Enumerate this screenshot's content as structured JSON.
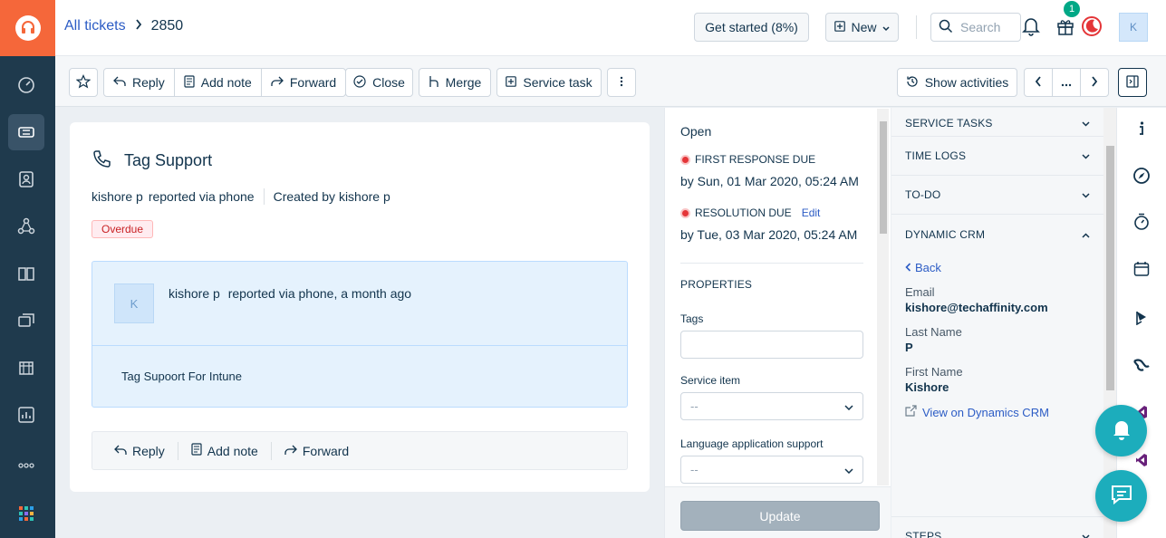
{
  "topbar": {
    "breadcrumb_root": "All tickets",
    "ticket_id": "2850",
    "get_started": "Get started (8%)",
    "new_label": "New",
    "search_placeholder": "Search",
    "gift_badge": "1",
    "avatar_initial": "K"
  },
  "toolbar": {
    "reply": "Reply",
    "add_note": "Add note",
    "forward": "Forward",
    "close": "Close",
    "merge": "Merge",
    "service_task": "Service task",
    "show_activities": "Show activities"
  },
  "ticket": {
    "subject": "Tag Support",
    "reporter": "kishore p",
    "reported_via": "reported via phone",
    "created_by": "Created by kishore p",
    "overdue_badge": "Overdue",
    "conversation": {
      "avatar_initial": "K",
      "author": "kishore p",
      "header_rest": "reported via phone, a month ago",
      "body": "Tag Supoort For Intune"
    },
    "reply_bar": {
      "reply": "Reply",
      "add_note": "Add note",
      "forward": "Forward"
    }
  },
  "properties": {
    "status": "Open",
    "first_response_label": "FIRST RESPONSE DUE",
    "first_response_value": "by Sun, 01 Mar 2020, 05:24 AM",
    "resolution_label": "RESOLUTION DUE",
    "resolution_edit": "Edit",
    "resolution_value": "by Tue, 03 Mar 2020, 05:24 AM",
    "section_title": "PROPERTIES",
    "tags_label": "Tags",
    "tags_value": "",
    "service_item_label": "Service item",
    "service_item_value": "--",
    "language_label": "Language application support",
    "language_value": "--",
    "update_button": "Update"
  },
  "apps": {
    "service_tasks": "SERVICE TASKS",
    "time_logs": "TIME LOGS",
    "todo": "TO-DO",
    "dynamic_crm": "DYNAMIC CRM",
    "back": "Back",
    "email_label": "Email",
    "email_value": "kishore@techaffinity.com",
    "last_name_label": "Last Name",
    "last_name_value": "P",
    "first_name_label": "First Name",
    "first_name_value": "Kishore",
    "view_link": "View on Dynamics CRM",
    "steps": "STEPS"
  },
  "colors": {
    "brand_orange": "#f5673a",
    "sidebar": "#1f3a4d",
    "link_blue": "#2c5cc5",
    "fab_teal": "#1cadbc",
    "overdue_red": "#c82124"
  }
}
